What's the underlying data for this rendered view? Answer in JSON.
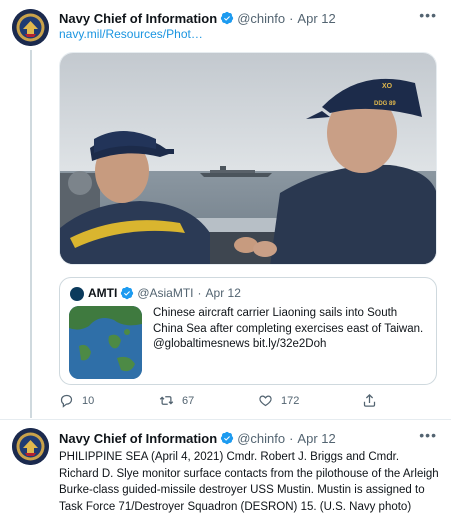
{
  "tweet1": {
    "name": "Navy Chief of Information",
    "handle": "@chinfo",
    "date": "Apr 12",
    "link": "navy.mil/Resources/Phot…",
    "quote": {
      "name": "AMTI",
      "handle": "@AsiaMTI",
      "date": "Apr 12",
      "text": "Chinese aircraft carrier Liaoning sails into South China Sea after completing exercises east of Taiwan. @globaltimesnews bit.ly/32e2Doh"
    },
    "actions": {
      "replies": "10",
      "retweets": "67",
      "likes": "172"
    },
    "cap_left": "",
    "cap_right": "XO",
    "cap_right_sub": "DDG 89"
  },
  "tweet2": {
    "name": "Navy Chief of Information",
    "handle": "@chinfo",
    "date": "Apr 12",
    "text": "PHILIPPINE SEA (April 4, 2021) Cmdr. Robert J. Briggs and Cmdr. Richard D. Slye monitor surface contacts from the pilothouse of the Arleigh Burke-class guided-missile destroyer USS Mustin. Mustin is assigned to Task Force 71/Destroyer Squadron (DESRON) 15. (U.S. Navy photo)"
  },
  "colors": {
    "accent": "#1b95e0",
    "verified": "#1d9bf0",
    "muted": "#536471"
  },
  "icons": [
    "verified-badge-icon",
    "more-icon",
    "reply-icon",
    "retweet-icon",
    "like-icon",
    "share-icon"
  ]
}
